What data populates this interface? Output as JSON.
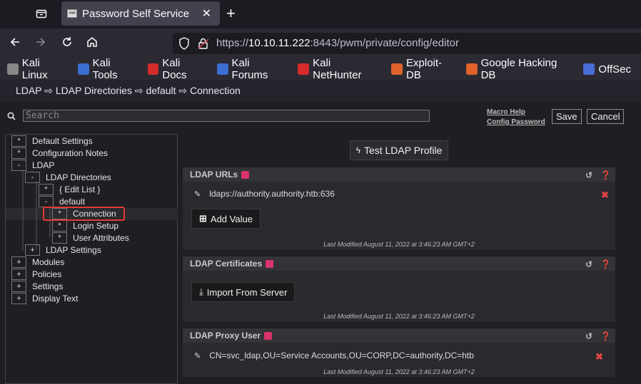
{
  "browser": {
    "tab_title": "Password Self Service",
    "tab_favicon_text": "PWM",
    "url_prefix": "https://",
    "url_host": "10.10.11.222",
    "url_rest": ":8443/pwm/private/config/editor",
    "bookmarks": [
      {
        "label": "Kali Linux",
        "icon": "kali-dragon-icon",
        "color": "#888888"
      },
      {
        "label": "Kali Tools",
        "icon": "kali-tools-icon",
        "color": "#3b6fd4"
      },
      {
        "label": "Kali Docs",
        "icon": "kali-docs-icon",
        "color": "#d42b2b"
      },
      {
        "label": "Kali Forums",
        "icon": "kali-forums-icon",
        "color": "#3b6fd4"
      },
      {
        "label": "Kali NetHunter",
        "icon": "kali-nethunter-icon",
        "color": "#d42b2b"
      },
      {
        "label": "Exploit-DB",
        "icon": "exploit-db-icon",
        "color": "#e0632b"
      },
      {
        "label": "Google Hacking DB",
        "icon": "ghdb-icon",
        "color": "#e0632b"
      },
      {
        "label": "OffSec",
        "icon": "offsec-icon",
        "color": "#4a6fd4"
      }
    ]
  },
  "page": {
    "breadcrumb": "LDAP ⇨ LDAP Directories ⇨ default ⇨ Connection",
    "search_placeholder": "Search",
    "help_links": [
      "Macro Help",
      "Config Password"
    ],
    "save_label": "Save",
    "cancel_label": "Cancel"
  },
  "tree": [
    {
      "box": "*",
      "label": "Default Settings"
    },
    {
      "box": "*",
      "label": "Configuration Notes"
    },
    {
      "box": "-",
      "label": "LDAP"
    },
    {
      "box": "-",
      "label": "LDAP Directories"
    },
    {
      "box": "*",
      "label": "{ Edit List }"
    },
    {
      "box": "-",
      "label": "default"
    },
    {
      "box": "*",
      "label": "Connection"
    },
    {
      "box": "*",
      "label": "Login Setup"
    },
    {
      "box": "*",
      "label": "User Attributes"
    },
    {
      "box": "+",
      "label": "LDAP Settings"
    },
    {
      "box": "+",
      "label": "Modules"
    },
    {
      "box": "+",
      "label": "Policies"
    },
    {
      "box": "+",
      "label": "Settings"
    },
    {
      "box": "+",
      "label": "Display Text"
    }
  ],
  "content": {
    "test_button": "Test LDAP Profile",
    "ldap_urls": {
      "title": "LDAP URLs",
      "value": "ldaps://authority.authority.htb:636",
      "add_button": "Add Value",
      "last_modified": "Last Modified August 11, 2022 at 3:46:23 AM GMT+2"
    },
    "ldap_certificates": {
      "title": "LDAP Certificates",
      "import_button": "Import From Server",
      "last_modified": "Last Modified August 11, 2022 at 3:46:23 AM GMT+2"
    },
    "ldap_proxy_user": {
      "title": "LDAP Proxy User",
      "value": "CN=svc_ldap,OU=Service Accounts,OU=CORP,DC=authority,DC=htb",
      "last_modified": "Last Modified August 11, 2022 at 3:46:23 AM GMT+2"
    }
  }
}
